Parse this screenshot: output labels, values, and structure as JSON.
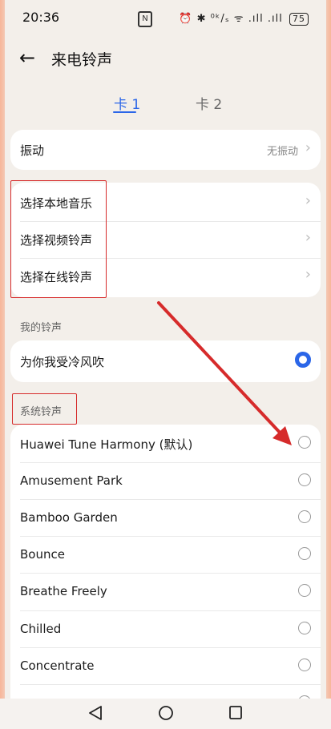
{
  "status_bar": {
    "time": "20:36",
    "nfc": "N",
    "icons": "⏰ ✱ ⁰ᵏ/ₛ ᯤ .ıll .ıll",
    "battery": "75"
  },
  "header": {
    "title": "来电铃声"
  },
  "tabs": [
    {
      "label": "卡 1",
      "active": true
    },
    {
      "label": "卡 2",
      "active": false
    }
  ],
  "vibration": {
    "label": "振动",
    "value": "无振动"
  },
  "sources": [
    {
      "label": "选择本地音乐"
    },
    {
      "label": "选择视频铃声"
    },
    {
      "label": "选择在线铃声"
    }
  ],
  "my_ringtones": {
    "header": "我的铃声",
    "items": [
      {
        "label": "为你我受冷风吹",
        "selected": true
      }
    ]
  },
  "system_ringtones": {
    "header": "系统铃声",
    "items": [
      {
        "label": "Huawei Tune Harmony (默认)",
        "selected": false
      },
      {
        "label": "Amusement Park",
        "selected": false
      },
      {
        "label": "Bamboo Garden",
        "selected": false
      },
      {
        "label": "Bounce",
        "selected": false
      },
      {
        "label": "Breathe Freely",
        "selected": false
      },
      {
        "label": "Chilled",
        "selected": false
      },
      {
        "label": "Concentrate",
        "selected": false
      }
    ]
  },
  "colors": {
    "accent": "#2b66e8",
    "annotation": "#d62b2b"
  }
}
